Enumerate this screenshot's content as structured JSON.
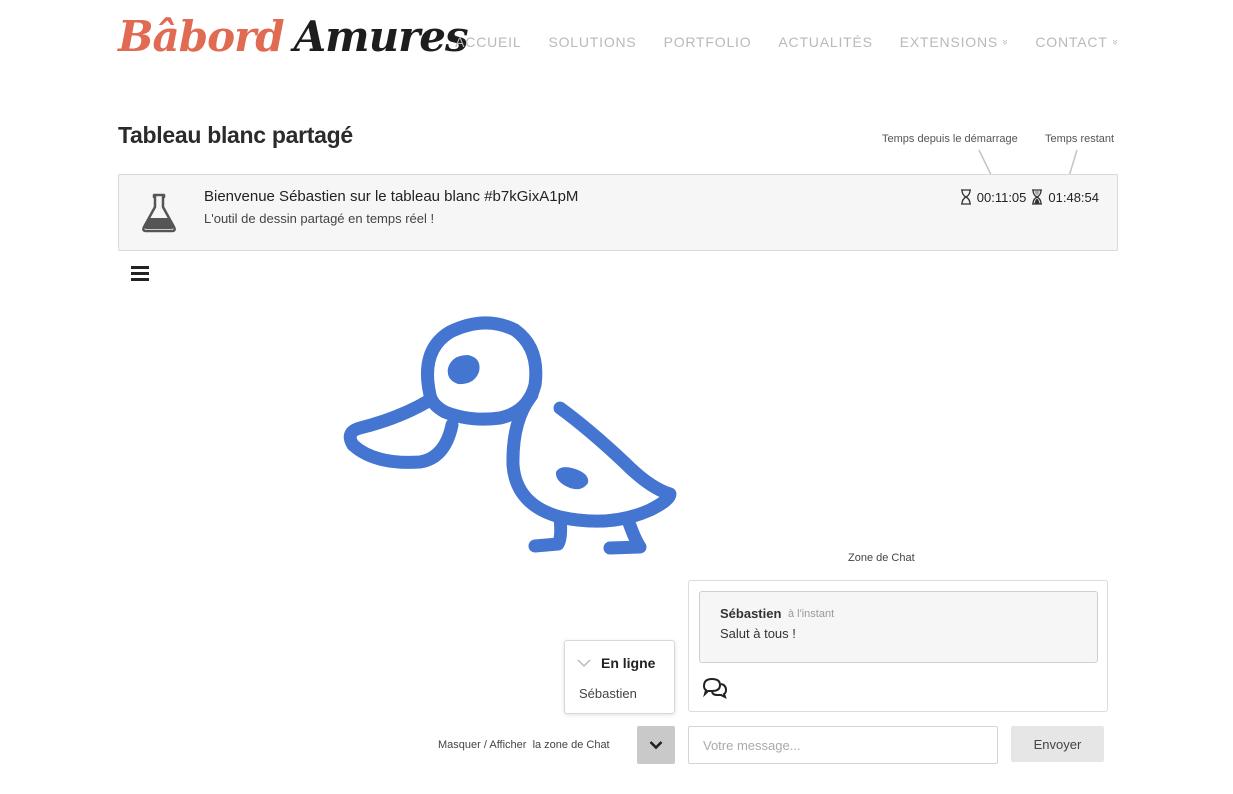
{
  "brand": {
    "part1": "Bâbord",
    "part2": "Amures",
    "accent": "#e06a52"
  },
  "nav": {
    "items": [
      {
        "label": "ACCUEIL",
        "dropdown": false
      },
      {
        "label": "SOLUTIONS",
        "dropdown": false
      },
      {
        "label": "PORTFOLIO",
        "dropdown": false
      },
      {
        "label": "ACTUALITÉS",
        "dropdown": false
      },
      {
        "label": "EXTENSIONS",
        "dropdown": true
      },
      {
        "label": "CONTACT",
        "dropdown": true
      }
    ],
    "dropdown_glyph": "»"
  },
  "page": {
    "title": "Tableau blanc partagé",
    "time_start_label": "Temps depuis le démarrage",
    "time_remaining_label": "Temps restant"
  },
  "welcome": {
    "icon": "flask-icon",
    "title": "Bienvenue Sébastien sur le tableau blanc #b7kGixA1pM",
    "subtitle": "L'outil de dessin partagé en temps réel !",
    "elapsed": "00:11:05",
    "remaining": "01:48:54"
  },
  "toolbar": {
    "menu_icon": "hamburger-icon"
  },
  "drawing": {
    "stroke_color": "#4475d1",
    "subject": "duck"
  },
  "chat": {
    "zone_label": "Zone de Chat",
    "messages": [
      {
        "author": "Sébastien",
        "time": "à l'instant",
        "text": "Salut à tous !"
      }
    ],
    "online_title": "En ligne",
    "online_users": [
      "Sébastien"
    ],
    "toggle_label": "Masquer / Afficher  la zone de Chat",
    "input_placeholder": "Votre message...",
    "send_label": "Envoyer"
  }
}
